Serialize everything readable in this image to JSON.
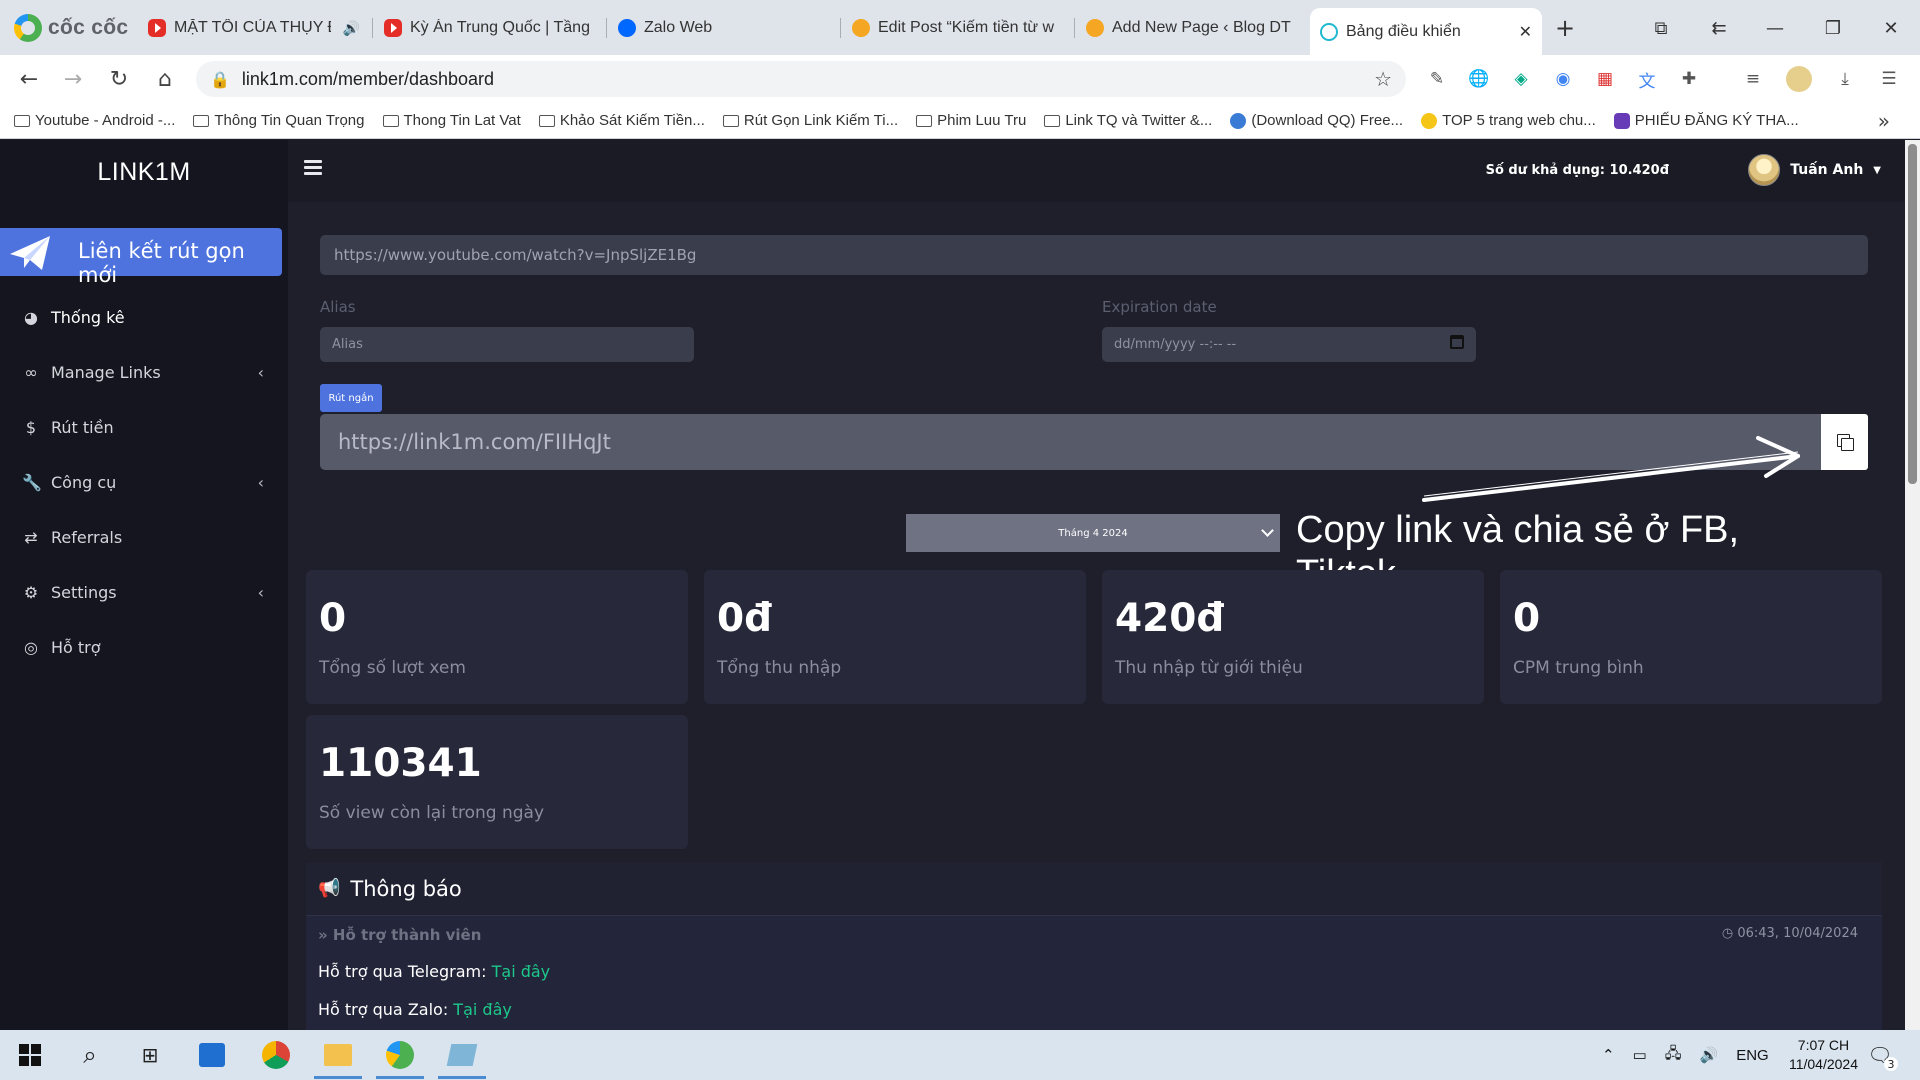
{
  "browser": {
    "brand": "cốc cốc",
    "tabs": [
      {
        "title": "MẶT TỐI CỦA THỤY Đ",
        "icon": "youtube-icon"
      },
      {
        "title": "Kỳ Án Trung Quốc | Tầng",
        "icon": "youtube-icon"
      },
      {
        "title": "Zalo Web",
        "icon": "zalo-icon"
      },
      {
        "title": "Edit Post “Kiếm tiền từ w",
        "icon": "blog-icon"
      },
      {
        "title": "Add New Page ‹ Blog DT",
        "icon": "blog-icon"
      },
      {
        "title": "Bảng điều khiển",
        "icon": "link-icon"
      }
    ],
    "url": "link1m.com/member/dashboard",
    "bookmarks": [
      "Youtube - Android -...",
      "Thông Tin Quan Trọng",
      "Thong Tin Lat Vat",
      "Khảo Sát Kiếm Tiền...",
      "Rút Gọn Link Kiếm Ti...",
      "Phim Luu Tru",
      "Link TQ và Twitter &...",
      "(Download QQ) Free...",
      "TOP 5 trang web chu...",
      "PHIẾU ĐĂNG KÝ THA..."
    ]
  },
  "app": {
    "logo": "LINK1M",
    "new_link_label": "Liên kết rút gọn mới",
    "menu": [
      {
        "label": "Thống kê",
        "icon": "dashboard-icon",
        "has_submenu": false
      },
      {
        "label": "Manage Links",
        "icon": "link-icon",
        "has_submenu": true
      },
      {
        "label": "Rút tiền",
        "icon": "dollar-icon",
        "has_submenu": false
      },
      {
        "label": "Công cụ",
        "icon": "wrench-icon",
        "has_submenu": true
      },
      {
        "label": "Referrals",
        "icon": "exchange-icon",
        "has_submenu": false
      },
      {
        "label": "Settings",
        "icon": "gears-icon",
        "has_submenu": true
      },
      {
        "label": "Hỗ trợ",
        "icon": "lifebuoy-icon",
        "has_submenu": false
      }
    ],
    "balance": "Số dư khả dụng: 10.420đ",
    "username": "Tuấn Anh"
  },
  "shorten_form": {
    "long_url_value": "https://www.youtube.com/watch?v=JnpSljZE1Bg",
    "alias_label": "Alias",
    "alias_placeholder": "Alias",
    "expiration_label": "Expiration date",
    "expiration_placeholder": "dd/mm/yyyy --:-- --",
    "submit_label": "Rút ngắn",
    "short_url": "https://link1m.com/FIIHqJt"
  },
  "month_filter": "Tháng 4 2024",
  "annotation": "Copy link và chia sẻ ở FB, Tiktok,....",
  "stats": [
    {
      "value": "0",
      "label": "Tổng số lượt xem"
    },
    {
      "value": "0đ",
      "label": "Tổng thu nhập"
    },
    {
      "value": "420đ",
      "label": "Thu nhập từ giới thiệu"
    },
    {
      "value": "0",
      "label": "CPM trung bình"
    },
    {
      "value": "110341",
      "label": "Số view còn lại trong ngày"
    }
  ],
  "notice": {
    "title": "Thông báo",
    "subtitle": "» Hỗ trợ thành viên",
    "time": "◷ 06:43, 10/04/2024",
    "lines": [
      {
        "text": "Hỗ trợ qua Telegram: ",
        "link": "Tại đây"
      },
      {
        "text": "Hỗ trợ qua Zalo: ",
        "link": "Tại đây"
      }
    ]
  },
  "taskbar": {
    "language": "ENG",
    "time": "7:07 CH",
    "date": "11/04/2024",
    "notifications": "3"
  }
}
